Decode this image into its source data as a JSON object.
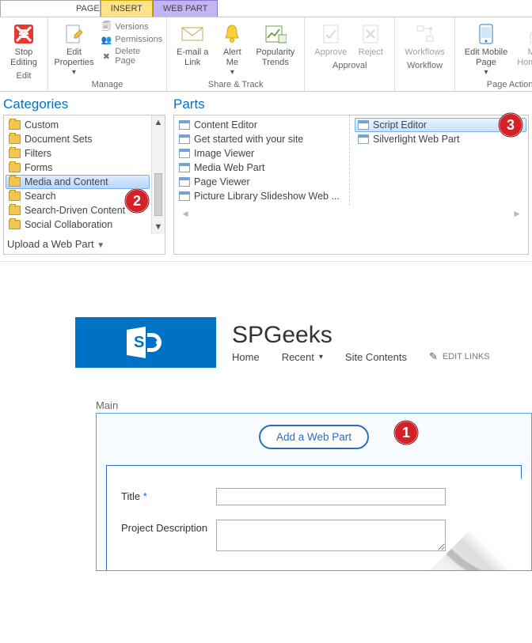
{
  "tabs": {
    "page": "PAGE",
    "insert": "INSERT",
    "webpart": "WEB PART"
  },
  "ribbon": {
    "stop_editing": "Stop Editing",
    "edit_properties": "Edit\nProperties",
    "versions": "Versions",
    "permissions": "Permissions",
    "delete_page": "Delete Page",
    "email_link": "E-mail a\nLink",
    "alert_me": "Alert\nMe",
    "popularity": "Popularity\nTrends",
    "approve": "Approve",
    "reject": "Reject",
    "workflows": "Workflows",
    "edit_mobile": "Edit Mobile\nPage",
    "make_homepage": "Make\nHomepage",
    "groups": {
      "edit": "Edit",
      "manage": "Manage",
      "share": "Share & Track",
      "approval": "Approval",
      "workflow": "Workflow",
      "page_actions": "Page Actions"
    }
  },
  "picker": {
    "categories_title": "Categories",
    "parts_title": "Parts",
    "categories": [
      "Custom",
      "Document Sets",
      "Filters",
      "Forms",
      "Media and Content",
      "Search",
      "Search-Driven Content",
      "Social Collaboration"
    ],
    "selected_category_index": 4,
    "parts_col1": [
      "Content Editor",
      "Get started with your site",
      "Image Viewer",
      "Media Web Part",
      "Page Viewer",
      "Picture Library Slideshow Web ..."
    ],
    "parts_col2": [
      "Script Editor",
      "Silverlight Web Part"
    ],
    "selected_part": "Script Editor",
    "upload": "Upload a Web Part"
  },
  "site": {
    "title": "SPGeeks",
    "nav": {
      "home": "Home",
      "recent": "Recent",
      "site_contents": "Site Contents",
      "edit_links": "EDIT LINKS"
    }
  },
  "zone": {
    "main": "Main",
    "add": "Add a Web Part",
    "title_lbl": "Title",
    "title_req": "*",
    "desc_lbl": "Project Description"
  },
  "badges": {
    "b1": "1",
    "b2": "2",
    "b3": "3"
  }
}
